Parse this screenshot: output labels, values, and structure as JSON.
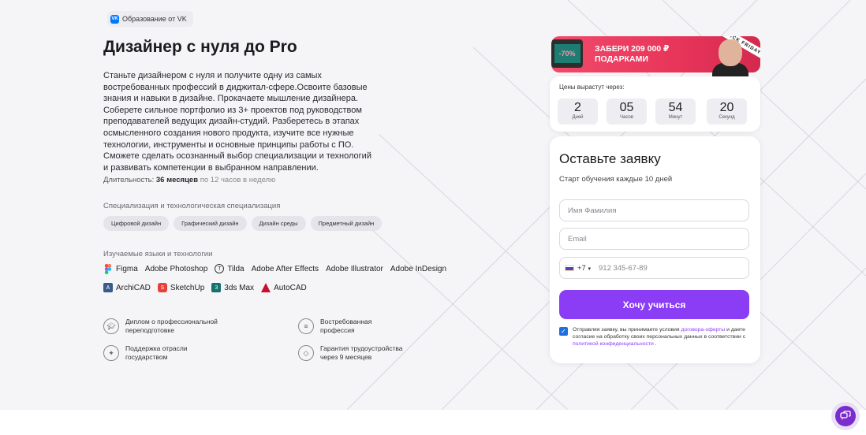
{
  "badge": {
    "icon": "vk-logo-icon",
    "logo_text": "VK",
    "label": "Образование от VK"
  },
  "title": "Дизайнер с нуля до Pro",
  "description": "Станьте дизайнером с нуля и получите одну из самых востребованных профессий в диджитал-сфере.Освоите базовые знания и навыки в дизайне. Прокачаете мышление дизайнера. Соберете сильное портфолио из 3+ проектов под руководством преподавателей ведущих дизайн-студий. Разберетесь в этапах осмысленного создания нового продукта, изучите все нужные технологии, инструменты и основные принципы работы с ПО. Сможете сделать осознанный выбор специализации и технологий и развивать компетенции в выбранном направлении.",
  "duration": {
    "label": "Длительность:",
    "value": "36 месяцев",
    "suffix": "по 12 часов в неделю"
  },
  "specialization": {
    "label": "Специализация и технологическая специализация",
    "chips": [
      "Цифровой дизайн",
      "Графический дизайн",
      "Дизайн среды",
      "Предметный дизайн"
    ]
  },
  "technologies": {
    "label": "Изучаемые языки и технологии",
    "row1": [
      {
        "name": "Figma",
        "icon": "figma-icon"
      },
      {
        "name": "Adobe Photoshop",
        "icon": ""
      },
      {
        "name": "Tilda",
        "icon": "tilda-icon"
      },
      {
        "name": "Adobe After Effects",
        "icon": ""
      },
      {
        "name": "Adobe Illustrator",
        "icon": ""
      },
      {
        "name": "Adobe InDesign",
        "icon": ""
      }
    ],
    "row2": [
      {
        "name": "ArchiCAD",
        "icon": "archicad-icon"
      },
      {
        "name": "SketchUp",
        "icon": "sketchup-icon"
      },
      {
        "name": "3ds Max",
        "icon": "3dsmax-icon"
      },
      {
        "name": "AutoCAD",
        "icon": "autocad-icon"
      }
    ]
  },
  "features": [
    {
      "icon": "graduation-cap-icon",
      "line1": "Диплом о профессиональной",
      "line2": "переподготовке"
    },
    {
      "icon": "clipboard-icon",
      "line1": "Востребованная",
      "line2": "профессия"
    },
    {
      "icon": "emblem-icon",
      "line1": "Поддержка отрасли",
      "line2": "государством"
    },
    {
      "icon": "shield-icon",
      "line1": "Гарантия трудоустройства",
      "line2": "через 9 месяцев"
    }
  ],
  "promo": {
    "discount": "-70%",
    "line1": "ЗАБЕРИ 209 000 ₽",
    "line2": "ПОДАРКАМИ",
    "tape": "BLACK FRIDAY"
  },
  "timer": {
    "label": "Цены вырастут через:",
    "units": [
      {
        "value": "2",
        "unit": "Дней"
      },
      {
        "value": "05",
        "unit": "Часов"
      },
      {
        "value": "54",
        "unit": "Минут"
      },
      {
        "value": "20",
        "unit": "Секунд"
      }
    ]
  },
  "form": {
    "title": "Оставьте заявку",
    "subtitle": "Старт обучения каждые 10 дней",
    "name_placeholder": "Имя Фамилия",
    "email_placeholder": "Email",
    "phone_code": "+7",
    "phone_placeholder": "912 345-67-89",
    "submit_label": "Хочу учиться",
    "consent": {
      "checked": true,
      "text1": "Отправляя заявку, вы принимаете условия ",
      "link1": "договора-оферты",
      "text2": " и даете согласие на обработку своих персональных данных в соответствии с ",
      "link2": "политикой конфиденциальности",
      "text3": " ."
    }
  },
  "colors": {
    "accent": "#8b3cf5",
    "promo": "#e8355a",
    "vk": "#0077ff"
  },
  "chat_button": {
    "icon": "chat-icon"
  }
}
